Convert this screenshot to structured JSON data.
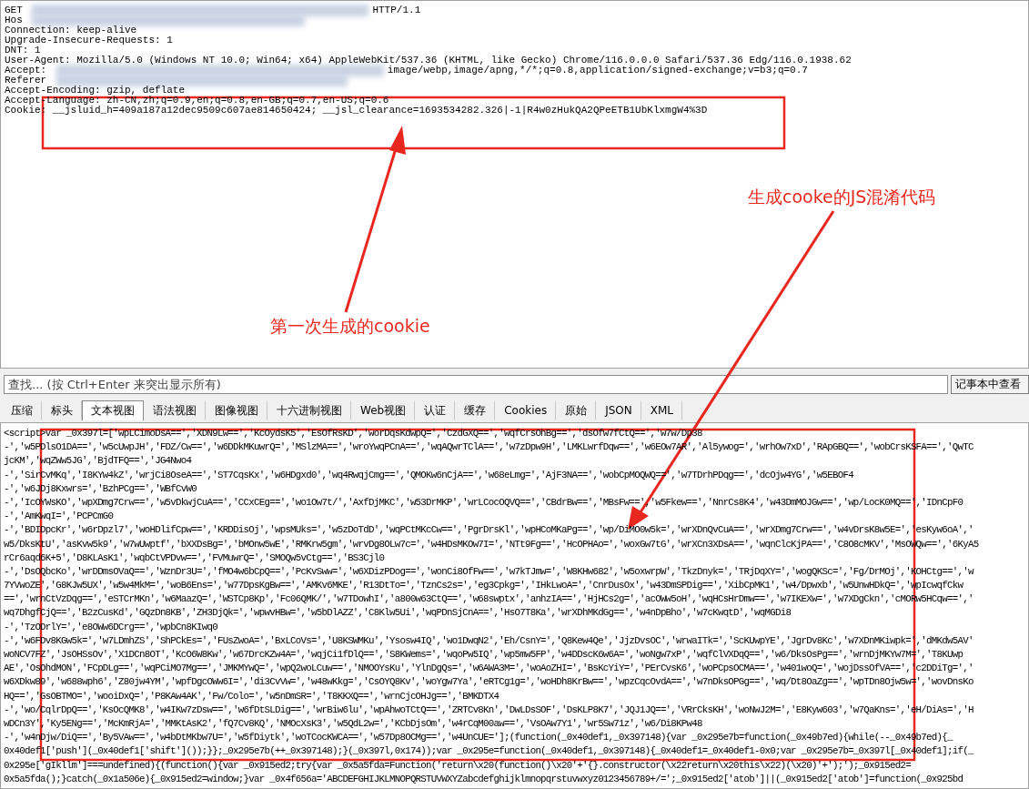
{
  "request_headers": {
    "lines": [
      {
        "parts": [
          {
            "kind": "text",
            "text": "GET"
          },
          {
            "kind": "redacted"
          },
          {
            "kind": "text",
            "text": "HTTP/1.1"
          }
        ]
      },
      {
        "parts": [
          {
            "kind": "text",
            "text": "Hos"
          },
          {
            "kind": "redacted"
          }
        ]
      },
      {
        "parts": [
          {
            "kind": "text",
            "text": "Connection: keep-alive"
          }
        ]
      },
      {
        "parts": [
          {
            "kind": "text",
            "text": "Upgrade-Insecure-Requests: 1"
          }
        ]
      },
      {
        "parts": [
          {
            "kind": "text",
            "text": "DNT: 1"
          }
        ]
      },
      {
        "parts": [
          {
            "kind": "text",
            "text": "User-Agent: Mozilla/5.0 (Windows NT 10.0; Win64; x64) AppleWebKit/537.36 (KHTML, like Gecko) Chrome/116.0.0.0 Safari/537.36 Edg/116.0.1938.62"
          }
        ]
      },
      {
        "parts": [
          {
            "kind": "text",
            "text": "Accept:"
          },
          {
            "kind": "redacted"
          },
          {
            "kind": "text",
            "text": "image/webp,image/apng,*/*;q=0.8,application/signed-exchange;v=b3;q=0.7"
          }
        ]
      },
      {
        "parts": [
          {
            "kind": "text",
            "text": "Referer"
          },
          {
            "kind": "redacted"
          }
        ]
      },
      {
        "parts": [
          {
            "kind": "text",
            "text": "Accept-Encoding: gzip, deflate"
          }
        ]
      },
      {
        "parts": [
          {
            "kind": "text",
            "text": "Accept-Language: zh-CN,zh;q=0.9,en;q=0.8,en-GB;q=0.7,en-US;q=0.6"
          }
        ]
      },
      {
        "parts": [
          {
            "kind": "text",
            "text": "Cookie: __jsluid_h=409a187a12dec9509c607ae814650424; __jsl_clearance=1693534282.326|-1|R4w0zHukQA2QPeETB1UbKlxmgW4%3D"
          }
        ]
      }
    ]
  },
  "find_bar": {
    "placeholder": "查找... (按 Ctrl+Enter 来突出显示所有)",
    "button": "记事本中查看"
  },
  "tabs": [
    {
      "label": "压缩",
      "selected": false
    },
    {
      "label": "标头",
      "selected": false
    },
    {
      "label": "文本视图",
      "selected": true
    },
    {
      "label": "语法视图",
      "selected": false
    },
    {
      "label": "图像视图",
      "selected": false
    },
    {
      "label": "十六进制视图",
      "selected": false
    },
    {
      "label": "Web视图",
      "selected": false
    },
    {
      "label": "认证",
      "selected": false
    },
    {
      "label": "缓存",
      "selected": false
    },
    {
      "label": "Cookies",
      "selected": false
    },
    {
      "label": "原始",
      "selected": false
    },
    {
      "label": "JSON",
      "selected": false
    },
    {
      "label": "XML",
      "selected": false
    }
  ],
  "response_body": {
    "lines": [
      "<script>var _0x397l=['wpLCimoDsA==','XDN9Lw==','KcOydsK5','EsOfRsKD','worDqsKdwpQ=','CzdGXQ==','wqfCrsOhBg==','dsOfw7fCtQ==','w7w/Dp38",
      "-','w5PDlsO1DA==','w5cUwpJH','FDZ/Cw==','w6DDkMKuwrQ=','MSlzMA==','wroYwqPCnA==','wqAQwrTClA==','w7zDpw9H','LMKLwrfDqw==','w6EOw7AR','Al5ywog=','wrhOw7xD','RApGBQ==','wobCrsKSFA==','QwTC",
      "jcKM','wqZWw5JG','BjdTFQ==','JG4Nwo4",
      "-','SirCvMKq','I8KYw4kZ','wrjCi8OseA==','ST7CqsKx','w6HDgxd0','wq4RwqjCmg==','QMOKw6nCjA==','w68eLmg=','AjF3NA==','wobCpMOQWQ==','w7TDrhPDqg==','dcOjw4YG','w5EBOF4",
      "-','w6JDj8Kxwrs=','BzhPCg==','WBfCvW0",
      "-','IcOYWsKO','wpXDmg7Crw==','w5vDkwjCuA==','CCxCEg==','wo1Ow7t/','AxfDjMKC','w53DrMKP','wrLCocOQVQ==','CBdrBw==','MBsFw==','w5Fkew==','NnrCs8K4','w43DmMOJGw==','wp/LocK0MQ==','IDnCpF0",
      "-','AmKwqI=','PCPCmG0",
      "-','BDIDpcKr','w6rDpzl7','woHDlifCpw==','KRDDisOj','wpsMUks=','w5zDoTdD','wqPCtMKcCw==','PgrDrsKl','wpHCoMKaPg==','wp/DiMO0w5k=','wrXDnQvCuA==','wrXDmg7Crw==','w4vDrsK8w5E=','esKyw6oA','",
      "w5/DksKtU','asKvw5k9','w7wUwptf','bXXDsBg=','bMOnw5wE','RMKrw5gm','wrvDg8OLw7c=','w4HDsMKOw7I=','NTt9Fg==','HcOPHAo=','woxGw7tG','wrXCn3XDsA==','wqnClcKjPA==','C8O8cMKV','MsOWQw==','6KyA5",
      "rCr6aqd6K+5','D8KLAsK1','wqbCtVPDvw==','FVMuwrQ=','SMOQw5vCtg==','BS3Cjl0",
      "-','DsOQbcKo','wrDDmsOVaQ==','WznDr3U=','fMO4w6bCpQ==','PcKvSww=','w6XDizPDog==','wonCi8OfFw==','w7kTJmw=','W8KHw682','w5oxwrpW','TkzDnyk=','TRjDqXY=','wogQKSc=','Fg/DrMOj','KOHCtg==','w",
      "7YVwoZE','G8KJw5UX','w5w4MkM=','woB6Ens=','w77DpsKgBw==','AMKv6MKE','R13DtTo=','TznCs2s=','eg3Cpkg=','IHkLwoA=','CnrDusOx','w43DmSPDig==','XibCpMK1','w4/Dpwxb','w5UnwHDkQ=','wpIcwqfCkw",
      "==','wrnCtVzDqg==','eSTCrMKn','w6MaazQ=','WSTCp8Kp','Fc06QMK/','w7TDowhI','a800w63CtQ==','w68swptx','anhzIA==','HjHCs2g=','acOWw5oH','wqHCsHrDmw==','w7IKEXw=','w7XDgCkn','cMORw5HCqw==','",
      "wq7DhgfCjQ==','B2zCusKd','GQzDn8KB','ZH3DjQk=','wpwvHBw=','w5bDlAZZ','C8Klw5Ui','wqPDnSjCnA==','HsO7T8Ka','wrXDhMKdGg==','w4nDpBho','w7cKwqtD','wqMGDi8",
      "-','TzODrlY=','e8OWw6DCrg==','wpbCn8KIwq0",
      "-','w6FDv8KGw5k=','w7LDmhZS','ShPCkEs=','FUsZwoA=','BxLCoVs=','U8KSWMKu','Ysosw4IQ','wo1DwqN2','Eh/CsnY=','Q8Kew4Qe','JjzDvsOC','wrwaITk=','ScKUwpYE','JgrDv8Kc','w7XDnMKiwpk=','dMKdw5AV'",
      "woNCV7FZ','JsOHSsOv','X1DCn8OT','KcO6W8Kw','w67DrcKZw4A=','wqjCi1fDlQ==','S8KWems=','wqoPw5IQ','wp5mw5FP','w4DDscK6w6A=','woNgw7xP','wqfClVXDqQ==','w6/DksOsPg==','wrnDjMKYw7M=','T8KUwp",
      "AE','OsOhdMON','FCpDLg==','wqPCiMO7Mg==','JMKMYwQ=','wpQ2woLCuw==','NMOOYsKu','YlnDgQs=','w6AWA3M=','woAoZHI=','BsKcYiY=','PErCvsK6','woPCpsOCMA==','w401woQ=','wojDssOfVA==','c2DDiTg=','",
      "w6XDkw89','w688wph6','Z80jw4YM','wpfDgcOWw6I=','di3CvVw=','w48wKkg=','CsOYQ8Kv','woYgw7Ya','eRTCg1g=','woHDh8KrBw==','wpzCqcOvdA==','w7nDksOPGg==','wq/Dt8OaZg==','wpTDn8Ojw5w=','wovDnsKo",
      "HQ==','GsOBTMO=','wooiDxQ=','P8KAw4AK','Fw/Colo=','w5nDmSR=','T8KKXQ==','wrnCjcOHJg==','BMKDTX4",
      "-','wo/CqlrDpQ==','KsOcQMK8','w4IKw7zDsw==','w6fDtSLDig==','wrBiw6lu','wpAhwoTCtQ==','ZRTCv8Kn','DwLDsSOF','DsKLP8K7','JQJ1JQ==','VRrCksKH','woNwJ2M=','E8Kyw603','w7QaKns=','eH/DiAs=','H",
      "wDCn3Y','Ky5ENg==','McKmRjA=','MMKtAsK2','fQ7Cv8KQ','NMOcXsK3','w5QdL2w=','KCbDjsOm','w4rCqM00aw==','VsOAw7Y1','wr5Sw71z','w6/Di8KPw48",
      "-','w4nDjw/DiQ==','By5VAw==','w4bDtMKbw7U=','w5fDiytk','woTCocKWCA==','w57Dp8OCMg==','w4UnCUE='];(function(_0x40def1,_0x397148){var _0x295e7b=function(_0x49b7ed){while(--_0x49b7ed){_",
      "0x40def1['push'](_0x40def1['shift']());}};_0x295e7b(++_0x397148);}(_0x397l,0x174));var _0x295e=function(_0x40def1,_0x397148){_0x40def1=_0x40def1-0x0;var _0x295e7b=_0x397l[_0x40def1];if(_",
      "0x295e['gIkllm']===undefined){(function(){var _0x915ed2;try{var _0x5a5fda=Function('return\\x20(function()\\x20'+'{}.constructor(\\x22return\\x20this\\x22)(\\x20)'+');');_0x915ed2=",
      "0x5a5fda();}catch(_0x1a506e){_0x915ed2=window;}var _0x4f656a='ABCDEFGHIJKLMNOPQRSTUVWXYZabcdefghijklmnopqrstuvwxyz0123456789+/=';_0x915ed2['atob']||(_0x915ed2['atob']=function(_0x925bd"
    ]
  },
  "annotations": [
    {
      "kind": "label",
      "text": "第一次生成的cookie"
    },
    {
      "kind": "label",
      "text": "生成cooke的JS混淆代码"
    }
  ]
}
